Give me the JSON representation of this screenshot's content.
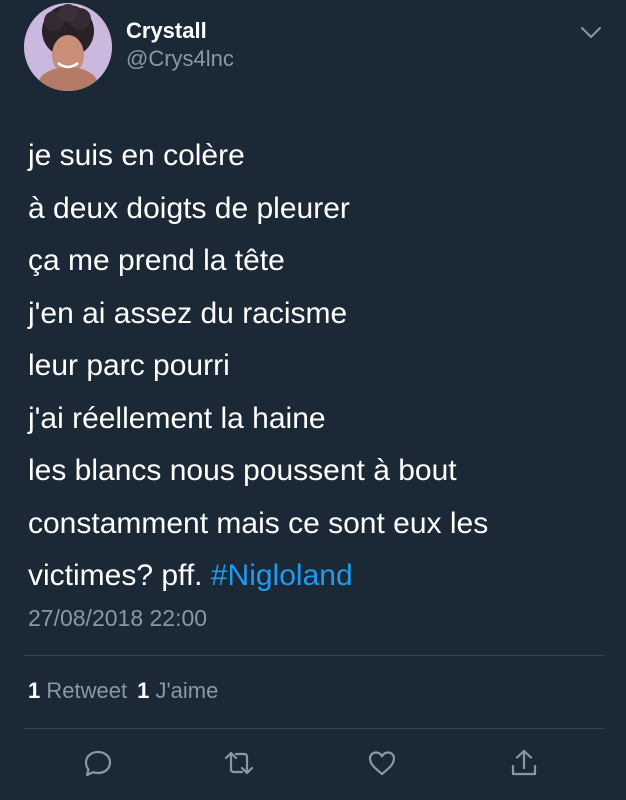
{
  "author": {
    "display_name": "Crystall",
    "handle": "@Crys4lnc"
  },
  "tweet": {
    "lines": [
      "je suis en colère",
      "à deux doigts de pleurer",
      "ça me prend la tête",
      "j'en ai assez du racisme",
      "leur parc pourri",
      "j'ai réellement la haine",
      "les blancs nous poussent à bout",
      "constamment mais ce sont eux les"
    ],
    "last_line_text": "victimes? pff.",
    "hashtag": "#Nigloland",
    "timestamp": "27/08/2018 22:00"
  },
  "stats": {
    "retweet_count": "1",
    "retweet_label": "Retweet",
    "like_count": "1",
    "like_label": "J'aime"
  },
  "colors": {
    "background": "#1b2836",
    "text": "#ffffff",
    "secondary": "#8899a6",
    "link": "#1d9bf0",
    "divider": "#38444d"
  },
  "icons": {
    "reply": "reply-icon",
    "retweet": "retweet-icon",
    "like": "heart-icon",
    "share": "share-icon",
    "menu": "chevron-down-icon"
  }
}
